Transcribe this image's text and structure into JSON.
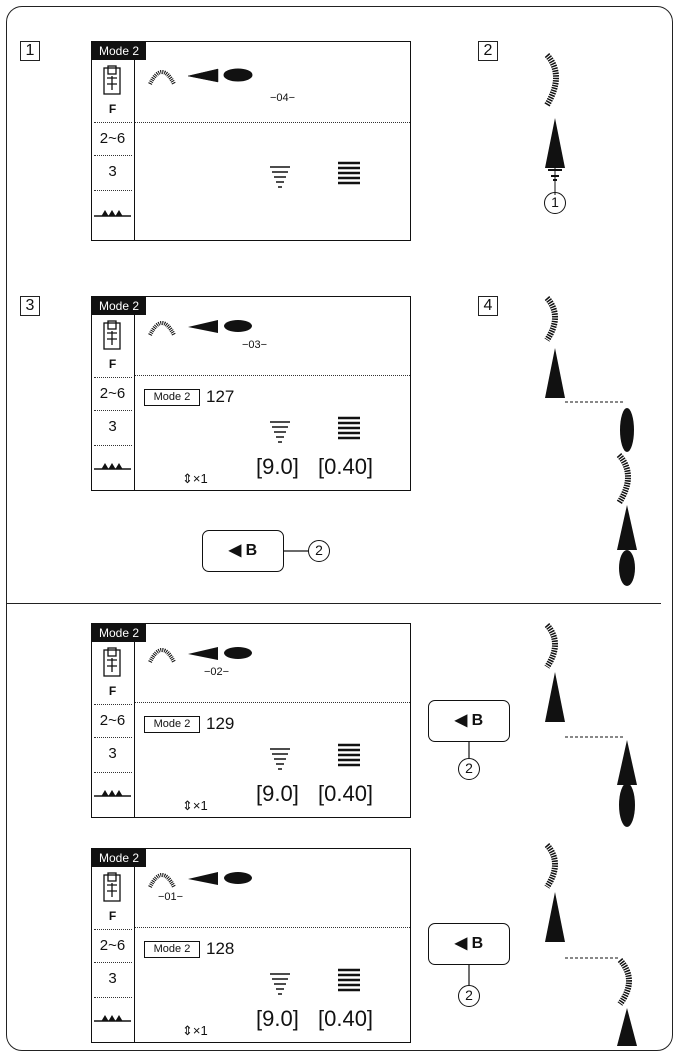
{
  "steps": [
    "1",
    "2",
    "3",
    "4"
  ],
  "lcd": {
    "mode": "Mode 2",
    "foot": "F",
    "width_range": "2~6",
    "tension": "3",
    "mode_small": "Mode 2",
    "width_value": "[9.0]",
    "length_value": "[0.40]",
    "repeat": "×1"
  },
  "screens": [
    {
      "page": "−04−",
      "pattern": ""
    },
    {
      "page": "−03−",
      "pattern": "127"
    },
    {
      "page": "−02−",
      "pattern": "129"
    },
    {
      "page": "−01−",
      "pattern": "128"
    }
  ],
  "button": {
    "label": "B"
  },
  "callouts": {
    "one": "1",
    "two": "2"
  }
}
